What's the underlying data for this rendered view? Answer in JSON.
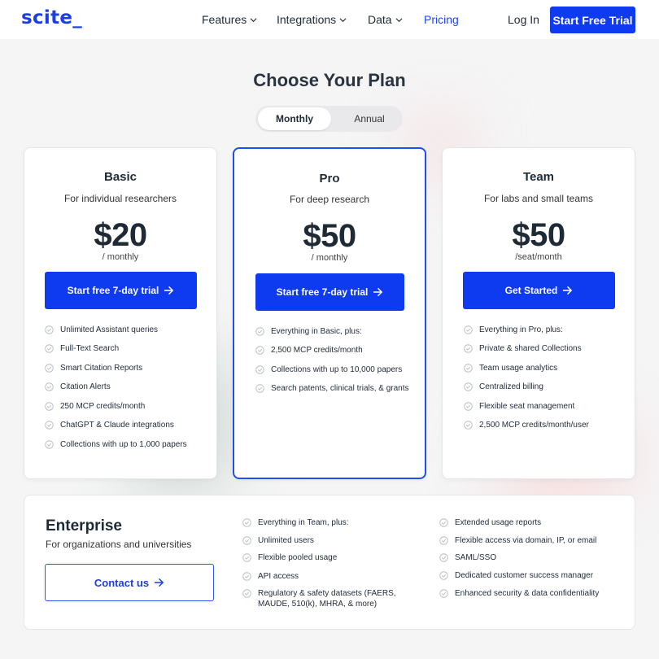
{
  "logo": "scite_",
  "nav": {
    "items": [
      {
        "label": "Features"
      },
      {
        "label": "Integrations"
      },
      {
        "label": "Data"
      },
      {
        "label": "Pricing"
      }
    ],
    "login": "Log In",
    "cta": "Start Free Trial"
  },
  "title": "Choose Your Plan",
  "billing_toggle": {
    "options": [
      "Monthly",
      "Annual"
    ],
    "selected": "Monthly"
  },
  "plans": [
    {
      "name": "Basic",
      "description": "For individual researchers",
      "price": "$20",
      "period": "/ monthly",
      "button": "Start free 7-day trial",
      "features": [
        "Unlimited Assistant queries",
        "Full-Text Search",
        "Smart Citation Reports",
        "Citation Alerts",
        "250 MCP credits/month",
        "ChatGPT & Claude integrations",
        "Collections with up to 1,000 papers"
      ]
    },
    {
      "name": "Pro",
      "description": "For deep research",
      "price": "$50",
      "period": "/ monthly",
      "button": "Start free 7-day trial",
      "features": [
        "Everything in Basic, plus:",
        "2,500 MCP credits/month",
        "Collections with up to 10,000 papers",
        "Search patents, clinical trials, & grants"
      ]
    },
    {
      "name": "Team",
      "description": "For labs and small teams",
      "price": "$50",
      "period": "/seat/month",
      "button": "Get Started",
      "features": [
        "Everything in Pro, plus:",
        "Private & shared Collections",
        "Team usage analytics",
        "Centralized billing",
        "Flexible seat management",
        "2,500 MCP credits/month/user"
      ]
    }
  ],
  "enterprise": {
    "name": "Enterprise",
    "description": "For organizations and universities",
    "button": "Contact us",
    "features_left": [
      "Everything in Team, plus:",
      "Unlimited users",
      "Flexible pooled usage",
      "API access",
      "Regulatory & safety datasets (FAERS, MAUDE, 510(k), MHRA, & more)"
    ],
    "features_right": [
      "Extended usage reports",
      "Flexible access via domain, IP, or email",
      "SAML/SSO",
      "Dedicated customer success manager",
      "Enhanced security & data confidentiality"
    ]
  },
  "colors": {
    "brand": "#0f3bf0",
    "check": "#b7bcc4"
  },
  "icons": {
    "nav_dropdown": "chevron-down-icon",
    "button_arrow": "arrow-right-icon",
    "feature_bullet": "check-circle-icon"
  }
}
